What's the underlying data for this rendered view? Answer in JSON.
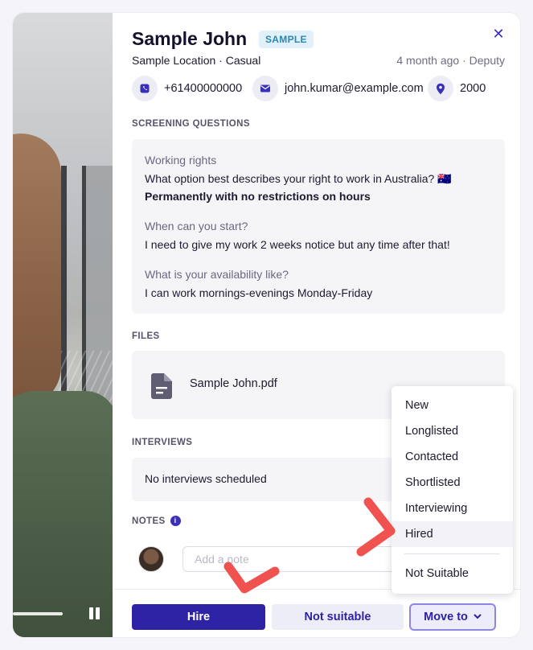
{
  "candidate": {
    "name": "Sample John",
    "badge": "SAMPLE",
    "location_line": "Sample Location · Casual",
    "meta": "4 month ago · Deputy",
    "phone": "+61400000000",
    "email": "john.kumar@example.com",
    "postcode": "2000"
  },
  "close_icon": "✕",
  "screening": {
    "label": "SCREENING QUESTIONS",
    "questions": [
      {
        "title": "Working rights",
        "text": "What option best describes your right to work in Australia? 🇦🇺",
        "answer": "Permanently with no restrictions on hours"
      },
      {
        "title": "When can you start?",
        "text": "I need to give my work 2 weeks notice but any time after that!"
      },
      {
        "title": "What is your availability like?",
        "text": "I can work mornings-evenings Monday-Friday"
      }
    ]
  },
  "files": {
    "label": "FILES",
    "items": [
      {
        "name": "Sample John.pdf"
      }
    ]
  },
  "interviews": {
    "label": "INTERVIEWS",
    "empty_text": "No interviews scheduled"
  },
  "notes": {
    "label": "NOTES",
    "info_glyph": "i",
    "placeholder": "Add a note"
  },
  "footer": {
    "hire_label": "Hire",
    "not_suitable_label": "Not suitable",
    "move_to_label": "Move to"
  },
  "move_menu": {
    "items": [
      "New",
      "Longlisted",
      "Contacted",
      "Shortlisted",
      "Interviewing",
      "Hired"
    ],
    "highlighted": "Hired",
    "after_separator": "Not Suitable"
  },
  "colors": {
    "accent": "#2e22a5",
    "badge_bg": "#e2f1f9",
    "badge_text": "#2a86b7",
    "annotation": "#f0534f"
  },
  "icons": {
    "phone": "phone-icon",
    "email": "mail-icon",
    "location": "location-pin-icon",
    "file": "document-icon",
    "pause": "pause-icon",
    "chevron": "chevron-down-icon"
  }
}
